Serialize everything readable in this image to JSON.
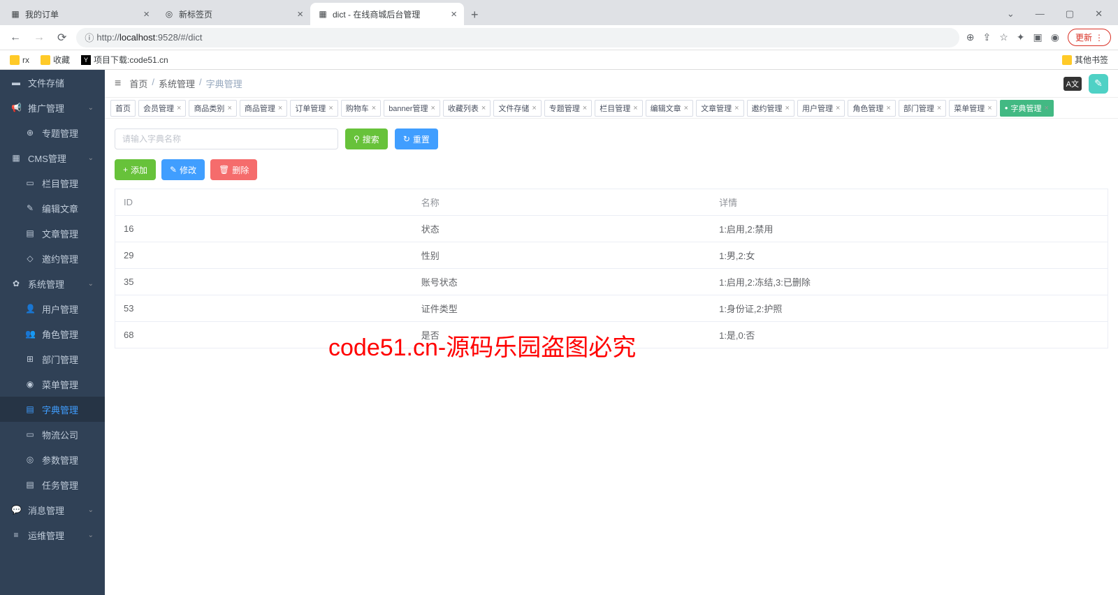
{
  "browser": {
    "tabs": [
      {
        "title": "我的订单"
      },
      {
        "title": "新标签页"
      },
      {
        "title": "dict - 在线商城后台管理"
      }
    ],
    "url_prefix": "ⓘ",
    "url": "http://localhost:9528/#/dict",
    "bookmarks": {
      "rx": "rx",
      "fav": "收藏",
      "download": "项目下载:code51.cn",
      "other": "其他书签"
    },
    "update": "更新",
    "window": {
      "min": "—",
      "max": "▢",
      "close": "✕",
      "dropdown": "⌄"
    }
  },
  "sidebar": {
    "items": [
      {
        "label": "文件存储"
      },
      {
        "label": "推广管理"
      },
      {
        "label": "专题管理"
      },
      {
        "label": "CMS管理"
      },
      {
        "label": "栏目管理"
      },
      {
        "label": "编辑文章"
      },
      {
        "label": "文章管理"
      },
      {
        "label": "邀约管理"
      },
      {
        "label": "系统管理"
      },
      {
        "label": "用户管理"
      },
      {
        "label": "角色管理"
      },
      {
        "label": "部门管理"
      },
      {
        "label": "菜单管理"
      },
      {
        "label": "字典管理"
      },
      {
        "label": "物流公司"
      },
      {
        "label": "参数管理"
      },
      {
        "label": "任务管理"
      },
      {
        "label": "消息管理"
      },
      {
        "label": "运维管理"
      }
    ]
  },
  "header": {
    "breadcrumb": [
      "首页",
      "系统管理",
      "字典管理"
    ],
    "lang": "A文"
  },
  "tabsbar": [
    "首页",
    "会员管理",
    "商品类别",
    "商品管理",
    "订单管理",
    "购物车",
    "banner管理",
    "收藏列表",
    "文件存储",
    "专题管理",
    "栏目管理",
    "编辑文章",
    "文章管理",
    "邀约管理",
    "用户管理",
    "角色管理",
    "部门管理",
    "菜单管理",
    "字典管理"
  ],
  "search": {
    "placeholder": "请输入字典名称",
    "search_btn": "搜索",
    "reset_btn": "重置"
  },
  "actions": {
    "add": "添加",
    "edit": "修改",
    "delete": "删除"
  },
  "table": {
    "columns": {
      "id": "ID",
      "name": "名称",
      "detail": "详情"
    },
    "rows": [
      {
        "id": "16",
        "name": "状态",
        "detail": "1:启用,2:禁用"
      },
      {
        "id": "29",
        "name": "性别",
        "detail": "1:男,2:女"
      },
      {
        "id": "35",
        "name": "账号状态",
        "detail": "1:启用,2:冻结,3:已删除"
      },
      {
        "id": "53",
        "name": "证件类型",
        "detail": "1:身份证,2:护照"
      },
      {
        "id": "68",
        "name": "是否",
        "detail": "1:是,0:否"
      }
    ]
  },
  "watermark": "code51.cn-源码乐园盗图必究"
}
